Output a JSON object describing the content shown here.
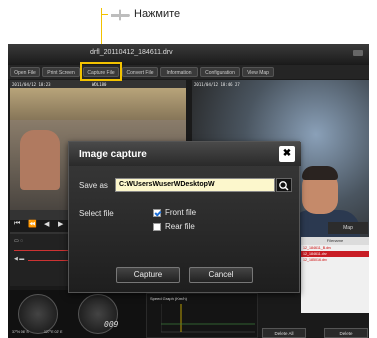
{
  "annotation": {
    "text": "Нажмите",
    "accent": "#f2c200"
  },
  "window": {
    "title": "drfl_20110412_184611.drv"
  },
  "menu": [
    {
      "label": "Open File"
    },
    {
      "label": "Print Screen"
    },
    {
      "label": "Capture File"
    },
    {
      "label": "Convert File"
    },
    {
      "label": "Information"
    },
    {
      "label": "Configuration"
    },
    {
      "label": "View Map"
    }
  ],
  "video": {
    "left_timestamp": "2011/04/12 18:23 ",
    "left_id": "WDL180",
    "right_timestamp": "2011/04/12 18:46 27"
  },
  "map_tab": "Map",
  "file_list": {
    "header": "Filename",
    "rows": [
      {
        "name": "12_184611_B.drv",
        "selected": false
      },
      {
        "name": "12_184611.drv",
        "selected": true
      },
      {
        "name": "12_185016.drv",
        "selected": false
      }
    ]
  },
  "gauges": {
    "left_label": "37°N 06' S",
    "right_label": "127°E 02' E",
    "digital_value": "009"
  },
  "speed_graph": {
    "title": "Speed Graph (Km/h)"
  },
  "bottom_buttons": [
    {
      "label": "Delete All"
    },
    {
      "label": "Delete"
    }
  ],
  "dialog": {
    "title": "Image capture",
    "save_as_label": "Save as",
    "path_value": "C:WUsersWuserWDesktopW",
    "select_file_label": "Select file",
    "options": [
      {
        "label": "Front file",
        "checked": true
      },
      {
        "label": "Rear file",
        "checked": false
      }
    ],
    "capture_label": "Capture",
    "cancel_label": "Cancel",
    "close_glyph": "✖"
  }
}
